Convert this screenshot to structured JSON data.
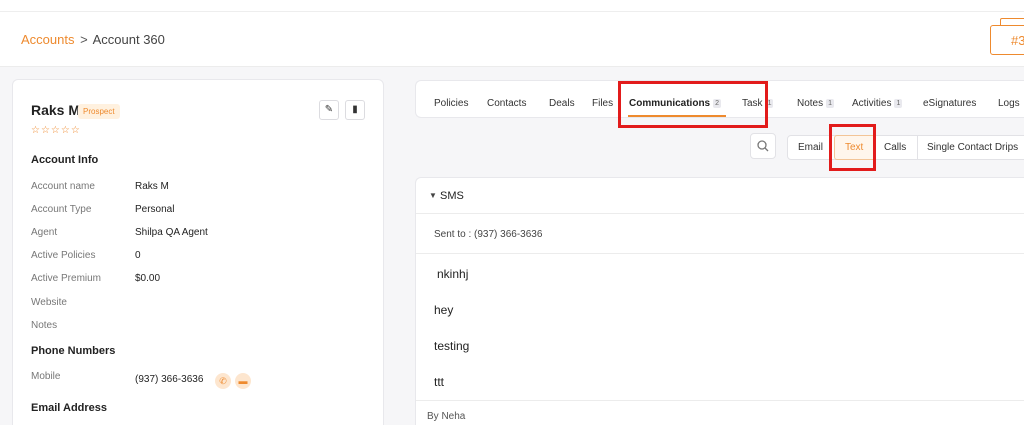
{
  "breadcrumb": {
    "parent": "Accounts",
    "separator": ">",
    "current": "Account 360"
  },
  "header": {
    "badge": "#3"
  },
  "account": {
    "name": "Raks M",
    "status": "Prospect",
    "stars": "☆☆☆☆☆",
    "info_heading": "Account Info",
    "fields": [
      {
        "label": "Account name",
        "value": "Raks M"
      },
      {
        "label": "Account Type",
        "value": "Personal"
      },
      {
        "label": "Agent",
        "value": "Shilpa QA Agent"
      },
      {
        "label": "Active Policies",
        "value": "0"
      },
      {
        "label": "Active Premium",
        "value": "$0.00"
      },
      {
        "label": "Website",
        "value": ""
      },
      {
        "label": "Notes",
        "value": ""
      }
    ],
    "phone_heading": "Phone Numbers",
    "phone": {
      "label": "Mobile",
      "value": "(937) 366-3636"
    },
    "email_heading": "Email Address"
  },
  "tabs": [
    {
      "label": "Policies"
    },
    {
      "label": "Contacts"
    },
    {
      "label": "Deals"
    },
    {
      "label": "Files"
    },
    {
      "label": "Communications",
      "count": "2"
    },
    {
      "label": "Task",
      "count": "1"
    },
    {
      "label": "Notes",
      "count": "1"
    },
    {
      "label": "Activities",
      "count": "1"
    },
    {
      "label": "eSignatures"
    },
    {
      "label": "Logs"
    }
  ],
  "subtabs": [
    {
      "label": "Email"
    },
    {
      "label": "Text"
    },
    {
      "label": "Calls"
    },
    {
      "label": "Single Contact Drips"
    }
  ],
  "sms": {
    "title": "SMS",
    "sent_to": "Sent to : (937) 366-3636",
    "messages": [
      "nkinhj",
      "hey",
      "testing",
      "ttt"
    ],
    "by": "By Neha"
  },
  "colors": {
    "accent": "#ee8a2e",
    "highlight": "#e21b1b"
  }
}
